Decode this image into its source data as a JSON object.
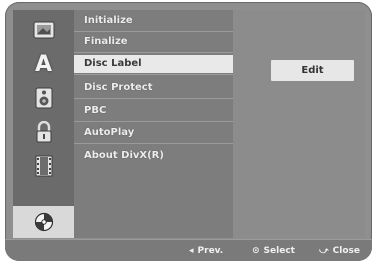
{
  "sidebar": {
    "icons": [
      {
        "name": "picture-icon"
      },
      {
        "name": "language-icon",
        "glyph": "A"
      },
      {
        "name": "audio-icon"
      },
      {
        "name": "lock-icon"
      },
      {
        "name": "film-icon"
      },
      {
        "name": "disc-icon"
      }
    ],
    "selected_index": 5
  },
  "menu": {
    "items": [
      {
        "label": "Initialize"
      },
      {
        "label": "Finalize"
      },
      {
        "label": "Disc Label"
      },
      {
        "label": "Disc Protect"
      },
      {
        "label": "PBC"
      },
      {
        "label": "AutoPlay"
      },
      {
        "label": "About DivX(R)"
      }
    ],
    "selected_index": 2
  },
  "option": {
    "button_label": "Edit"
  },
  "footer": {
    "prev_icon": "◂",
    "prev_label": "Prev.",
    "select_icon": "⊙",
    "select_label": "Select",
    "close_icon": "⤻",
    "close_label": "Close"
  },
  "colors": {
    "background": "#8f8f8f",
    "selected_highlight": "#e9e9e9",
    "text": "#ededed"
  }
}
